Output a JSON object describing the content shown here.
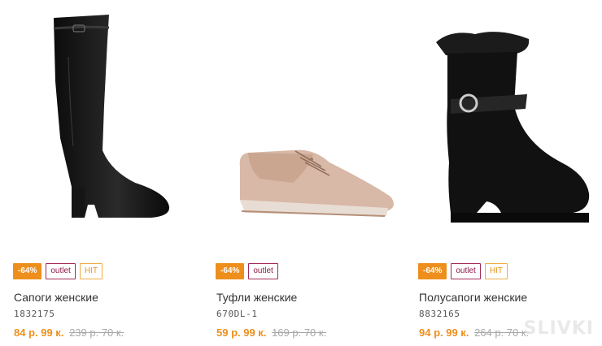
{
  "products": [
    {
      "image_name": "tall-black-leather-boot",
      "badges": {
        "sale": "-64%",
        "outlet": "outlet",
        "hit": "HIT"
      },
      "title": "Сапоги женские",
      "sku": "1832175",
      "price_new": "84 р. 99 к.",
      "price_old": "239 р. 70 к."
    },
    {
      "image_name": "beige-lace-up-shoe",
      "badges": {
        "sale": "-64%",
        "outlet": "outlet"
      },
      "title": "Туфли женские",
      "sku": "670DL-1",
      "price_new": "59 р. 99 к.",
      "price_old": "169 р. 70 к."
    },
    {
      "image_name": "black-suede-fur-ankle-boot",
      "badges": {
        "sale": "-64%",
        "outlet": "outlet",
        "hit": "HIT"
      },
      "title": "Полусапоги женские",
      "sku": "8832165",
      "price_new": "94 р. 99 к.",
      "price_old": "264 р. 70 к."
    }
  ],
  "watermark": "SLIVKI",
  "colors": {
    "sale_badge": "#ee8f1d",
    "outlet_badge": "#a12a58",
    "hit_badge": "#f0ac44",
    "price_new": "#ee8f1d",
    "price_old": "#a8a8a8"
  }
}
